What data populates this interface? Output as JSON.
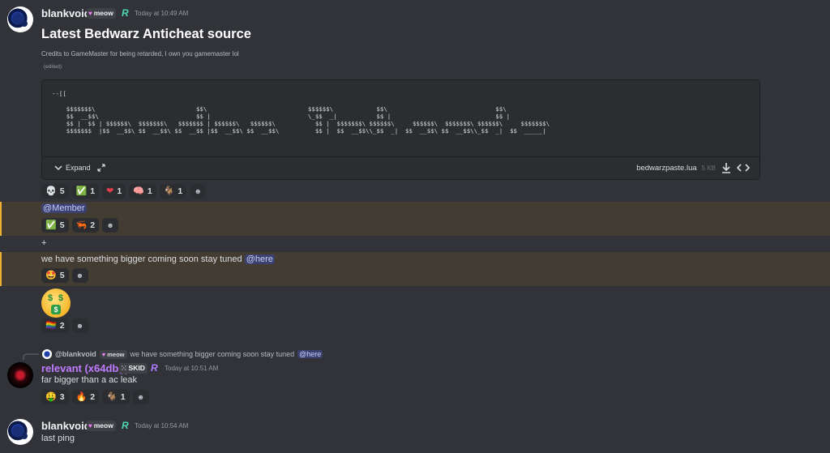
{
  "messages": {
    "m1": {
      "username": "blankvoid",
      "badge": "meow",
      "timestamp": "Today at 10:49 AM",
      "title": "Latest Bedwarz Anticheat source",
      "subtitle": "Credits to GameMaster for being retarded, I own you gamemaster lol",
      "edited": "(edited)",
      "code": {
        "line1": "--[[",
        "line2": "",
        "line3": "    $$$$$$$\\                            $$\\                            $$$$$$\\            $$\\                              $$\\",
        "line4": "    $$  __$$\\                           $$ |                           \\_$$  _|           $$ |                             $$ |",
        "line5": "    $$ |  $$ | $$$$$$\\  $$$$$$$\\   $$$$$$$ | $$$$$$\\   $$$$$$\\           $$ |  $$$$$$$\\ $$$$$$\\     $$$$$$\\  $$$$$$$\\ $$$$$$\\     $$$$$$$\\",
        "line6": "    $$$$$$$  |$$  __$$\\ $$  __$$\\ $$  __$$ |$$  __$$\\ $$  __$$\\          $$ |  $$  __$$\\\\_$$  _|  $$  __$$\\ $$  __$$\\\\_$$  _|  $$  _____|",
        "expand_label": "Expand",
        "filename": "bedwarzpaste.lua",
        "filesize": "5 KB"
      },
      "reactions": [
        {
          "emoji": "💀",
          "count": "5"
        },
        {
          "emoji": "✅",
          "count": "1"
        },
        {
          "emoji": "❤",
          "count": "1"
        },
        {
          "emoji": "🧠",
          "count": "1"
        },
        {
          "emoji": "🐐",
          "count": "1"
        }
      ]
    },
    "m2": {
      "mention": "@Member",
      "reactions": [
        {
          "emoji": "✅",
          "count": "5"
        },
        {
          "emoji": "🦐",
          "count": "2"
        }
      ]
    },
    "m3": {
      "text": "+"
    },
    "m4": {
      "text": "we have something bigger coming soon stay tuned",
      "mention": "@here",
      "reactions": [
        {
          "emoji": "🤩",
          "count": "5"
        }
      ]
    },
    "m5": {
      "reactions": [
        {
          "emoji": "🏳‍🌈",
          "count": "2"
        }
      ]
    },
    "m6": {
      "reply": {
        "username": "@blankvoid",
        "badge": "meow",
        "text": "we have something bigger coming soon stay tuned",
        "mention": "@here"
      },
      "username": "relevant (x64dbg)",
      "badge": "SKID",
      "timestamp": "Today at 10:51 AM",
      "text": "far bigger than a ac leak",
      "reactions": [
        {
          "emoji": "🤑",
          "count": "3"
        },
        {
          "emoji": "🔥",
          "count": "2"
        },
        {
          "emoji": "🐐",
          "count": "1"
        }
      ]
    },
    "m7": {
      "username": "blankvoid",
      "badge": "meow",
      "timestamp": "Today at 10:54 AM",
      "text": "last ping"
    }
  },
  "colors": {
    "background": "#313338",
    "highlight": "#433c33",
    "mention_bg": "#3c4270",
    "username_purple": "#c07cff"
  },
  "icons": {
    "add_reaction": "smiley-add-icon",
    "download": "download-icon",
    "code": "code-icon",
    "expand": "chevron-down-icon"
  }
}
